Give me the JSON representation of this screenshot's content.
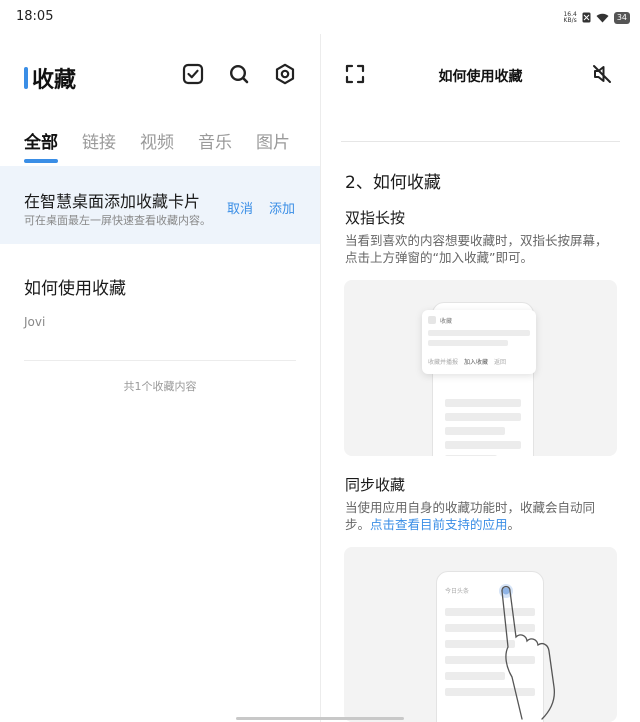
{
  "status": {
    "time": "18:05",
    "net_speed_value": "16.4",
    "net_speed_unit": "KB/s",
    "battery": "34"
  },
  "left": {
    "title": "收藏",
    "tabs": [
      "全部",
      "链接",
      "视频",
      "音乐",
      "图片"
    ],
    "banner": {
      "title": "在智慧桌面添加收藏卡片",
      "subtitle": "可在桌面最左一屏快速查看收藏内容。",
      "cancel": "取消",
      "add": "添加"
    },
    "item": {
      "title": "如何使用收藏",
      "source": "Jovi"
    },
    "count": "共1个收藏内容"
  },
  "right": {
    "title": "如何使用收藏",
    "section": "2、如何收藏",
    "h1": "双指长按",
    "p1": "当看到喜欢的内容想要收藏时，双指长按屏幕，点击上方弹窗的“加入收藏”即可。",
    "illus1": {
      "popup_title": "收藏",
      "actions": [
        "收藏并播报",
        "加入收藏",
        "返回"
      ]
    },
    "h2": "同步收藏",
    "p2_text": "当使用应用自身的收藏功能时，收藏会自动同步。",
    "p2_link": "点击查看目前支持的应用",
    "p2_end": "。",
    "illus2": {
      "label": "今日头条"
    }
  },
  "colors": {
    "accent": "#3a8ee6",
    "banner_bg": "#eef4fb"
  },
  "icons": [
    "check-square-icon",
    "search-icon",
    "settings-hex-icon",
    "fullscreen-icon",
    "mute-icon"
  ]
}
